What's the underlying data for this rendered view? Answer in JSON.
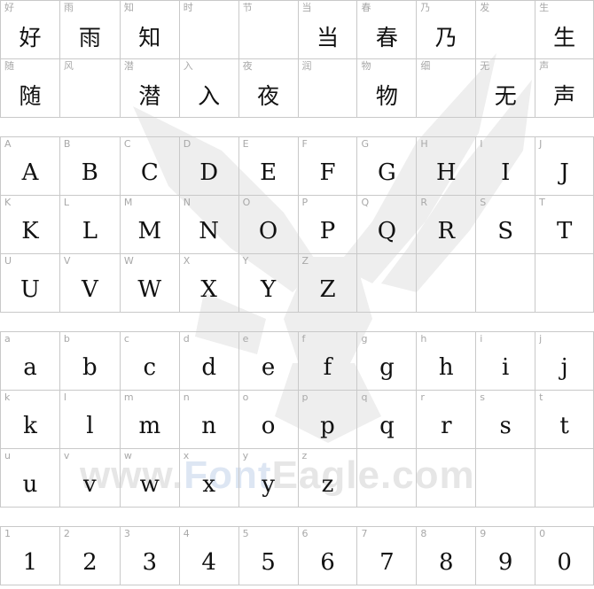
{
  "watermark": {
    "pre": "www.",
    "accent": "Font",
    "post": "Eagle.com"
  },
  "chinese_rows": [
    [
      {
        "label": "好",
        "glyph": "好"
      },
      {
        "label": "雨",
        "glyph": "雨"
      },
      {
        "label": "知",
        "glyph": "知"
      },
      {
        "label": "时",
        "glyph": ""
      },
      {
        "label": "节",
        "glyph": ""
      },
      {
        "label": "当",
        "glyph": "当"
      },
      {
        "label": "春",
        "glyph": "春"
      },
      {
        "label": "乃",
        "glyph": "乃"
      },
      {
        "label": "发",
        "glyph": ""
      },
      {
        "label": "生",
        "glyph": "生"
      }
    ],
    [
      {
        "label": "随",
        "glyph": "随"
      },
      {
        "label": "风",
        "glyph": ""
      },
      {
        "label": "潜",
        "glyph": "潜"
      },
      {
        "label": "入",
        "glyph": "入"
      },
      {
        "label": "夜",
        "glyph": "夜"
      },
      {
        "label": "润",
        "glyph": ""
      },
      {
        "label": "物",
        "glyph": "物"
      },
      {
        "label": "细",
        "glyph": ""
      },
      {
        "label": "无",
        "glyph": "无"
      },
      {
        "label": "声",
        "glyph": "声"
      }
    ]
  ],
  "upper_rows": [
    [
      "A",
      "B",
      "C",
      "D",
      "E",
      "F",
      "G",
      "H",
      "I",
      "J"
    ],
    [
      "K",
      "L",
      "M",
      "N",
      "O",
      "P",
      "Q",
      "R",
      "S",
      "T"
    ],
    [
      "U",
      "V",
      "W",
      "X",
      "Y",
      "Z",
      "",
      "",
      "",
      ""
    ]
  ],
  "lower_rows": [
    [
      "a",
      "b",
      "c",
      "d",
      "e",
      "f",
      "g",
      "h",
      "i",
      "j"
    ],
    [
      "k",
      "l",
      "m",
      "n",
      "o",
      "p",
      "q",
      "r",
      "s",
      "t"
    ],
    [
      "u",
      "v",
      "w",
      "x",
      "y",
      "z",
      "",
      "",
      "",
      ""
    ]
  ],
  "digit_rows": [
    [
      "1",
      "2",
      "3",
      "4",
      "5",
      "6",
      "7",
      "8",
      "9",
      "0"
    ]
  ]
}
